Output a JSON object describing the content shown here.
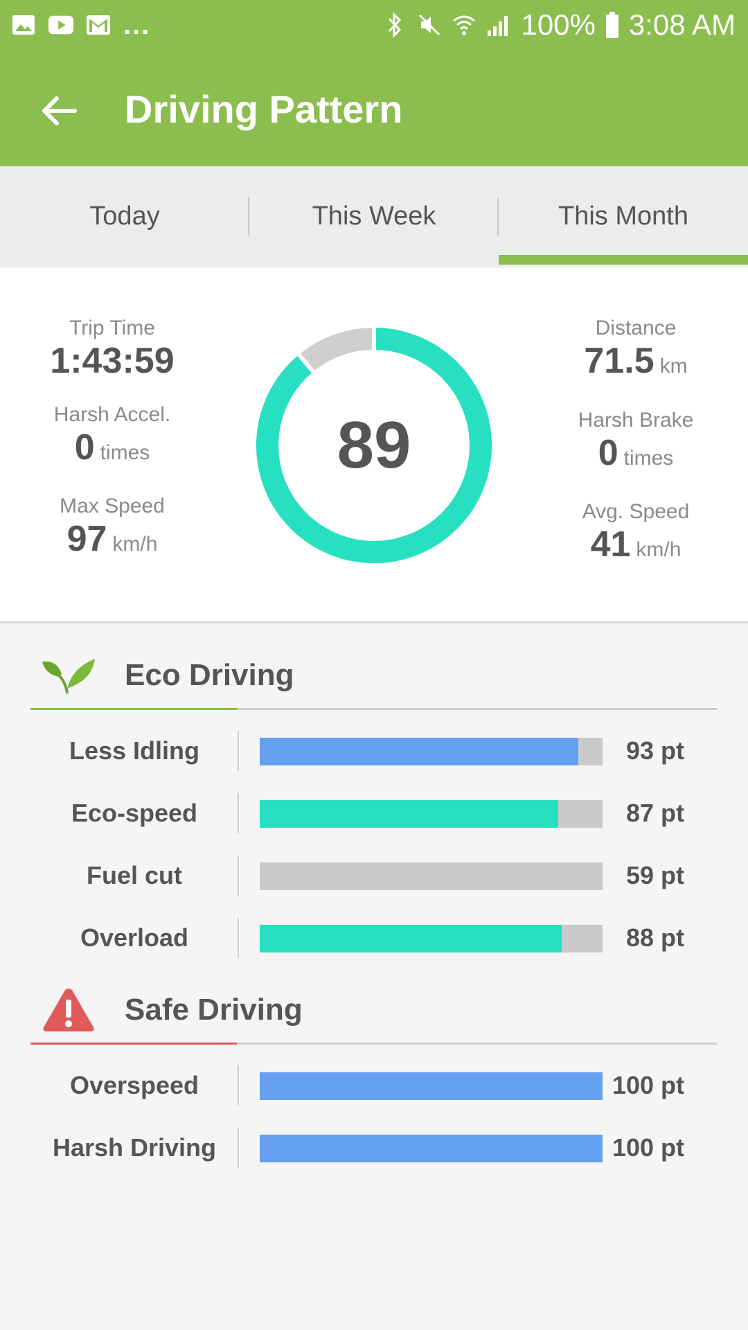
{
  "status_bar": {
    "icons_left": [
      "image-icon",
      "youtube-icon",
      "gmail-icon"
    ],
    "more": "...",
    "icons_right": [
      "bluetooth-icon",
      "mute-icon",
      "wifi-icon",
      "signal-icon"
    ],
    "battery": "100%",
    "time": "3:08 AM"
  },
  "app_bar": {
    "title": "Driving Pattern"
  },
  "tabs": [
    {
      "label": "Today"
    },
    {
      "label": "This Week"
    },
    {
      "label": "This Month"
    }
  ],
  "selected_tab": "This Month",
  "summary": {
    "score": "89",
    "score_fraction": 0.89,
    "trip_time": {
      "label": "Trip Time",
      "value": "1:43:59"
    },
    "harsh_accel": {
      "label": "Harsh Accel.",
      "value": "0",
      "unit": "times"
    },
    "max_speed": {
      "label": "Max Speed",
      "value": "97",
      "unit": "km/h"
    },
    "distance": {
      "label": "Distance",
      "value": "71.5",
      "unit": "km"
    },
    "harsh_brake": {
      "label": "Harsh Brake",
      "value": "0",
      "unit": "times"
    },
    "avg_speed": {
      "label": "Avg. Speed",
      "value": "41",
      "unit": "km/h"
    }
  },
  "eco_section": {
    "title": "Eco Driving",
    "icon": "leaf-icon",
    "accent_color": "#8bbd4f",
    "metrics": [
      {
        "label": "Less Idling",
        "score": "93 pt",
        "value": 93,
        "color": "#64a0ef"
      },
      {
        "label": "Eco-speed",
        "score": "87 pt",
        "value": 87,
        "color": "#27e0c1"
      },
      {
        "label": "Fuel cut",
        "score": "59 pt",
        "value": 0,
        "color": "#cacaca"
      },
      {
        "label": "Overload",
        "score": "88 pt",
        "value": 88,
        "color": "#27e0c1"
      }
    ]
  },
  "safe_section": {
    "title": "Safe Driving",
    "icon": "warning-icon",
    "accent_color": "#e05a5a",
    "metrics": [
      {
        "label": "Overspeed",
        "score": "100 pt",
        "value": 100,
        "color": "#64a0ef"
      },
      {
        "label": "Harsh Driving",
        "score": "100 pt",
        "value": 100,
        "color": "#64a0ef"
      }
    ]
  },
  "colors": {
    "brand_green": "#8bbd4f",
    "gauge_fill": "#27e0c1",
    "gauge_track": "#cfcfcf"
  }
}
